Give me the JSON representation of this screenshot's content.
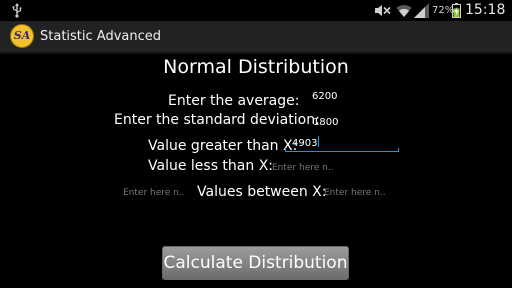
{
  "status_bar": {
    "battery_percent": "72%",
    "battery_level": 0.72,
    "time": "15:18",
    "icons": [
      "usb-icon",
      "mute-icon",
      "wifi-icon",
      "signal-icon",
      "battery-icon"
    ]
  },
  "app": {
    "icon_glyph": "SA",
    "title": "Statistic Advanced"
  },
  "main": {
    "heading": "Normal Distribution",
    "average": {
      "label": "Enter the average:",
      "value": "6200"
    },
    "std_dev": {
      "label": "Enter the standard deviation:",
      "value": "1800"
    },
    "greater_than": {
      "label": "Value greater than X:",
      "value": "4903"
    },
    "less_than": {
      "label": "Value less than X:",
      "placeholder": "Enter here n.."
    },
    "between": {
      "label": "Values between X:",
      "lower_placeholder": "Enter here n..",
      "upper_placeholder": "Enter here n.."
    },
    "button_label": "Calculate Distribution"
  },
  "colors": {
    "background": "#000000",
    "action_bar": "#222222",
    "focus_accent": "#2f8fd6",
    "button": "#808080",
    "placeholder": "#777777"
  }
}
